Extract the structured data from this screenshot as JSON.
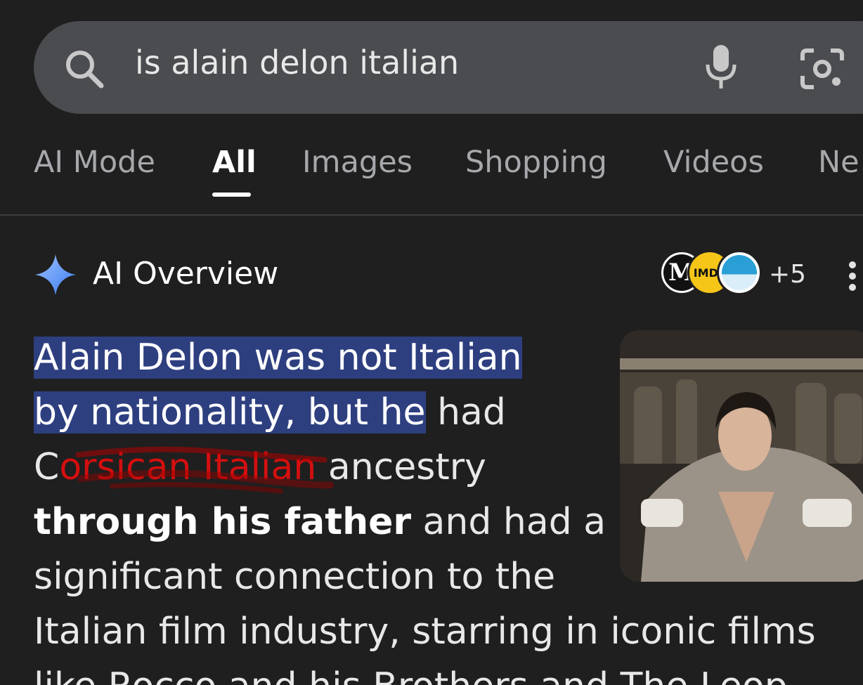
{
  "search": {
    "query": "is alain delon italian"
  },
  "tabs": [
    {
      "label": "AI Mode"
    },
    {
      "label": "All"
    },
    {
      "label": "Images"
    },
    {
      "label": "Shopping"
    },
    {
      "label": "Videos"
    },
    {
      "label": "Ne"
    }
  ],
  "ai_overview": {
    "title": "AI Overview",
    "sources_more": "+5",
    "source_icons": [
      "le-monde-logo",
      "imdb-logo",
      "france24-logo"
    ],
    "source_1_letter": "M",
    "source_2_label": "IMDb",
    "text": {
      "l1": "Alain Delon was not Italian",
      "l2a": "by nationality, but he",
      "l2b": " had",
      "l3a": "C",
      "l3b": "orsican Italian",
      "l3c": " ancestry",
      "l4a": "through his father",
      "l4b": "  and had a",
      "l5": "significant connection to the",
      "l6": "Italian film industry, starring in iconic films",
      "l7": "like Rocco and his Brothers and The Leop"
    }
  },
  "colors": {
    "background": "#1f1f1f",
    "search_bar": "#4a4c50",
    "highlight": "#2e3f80",
    "red_annotation": "#d40f0f",
    "sparkle": "#4f8df5"
  }
}
